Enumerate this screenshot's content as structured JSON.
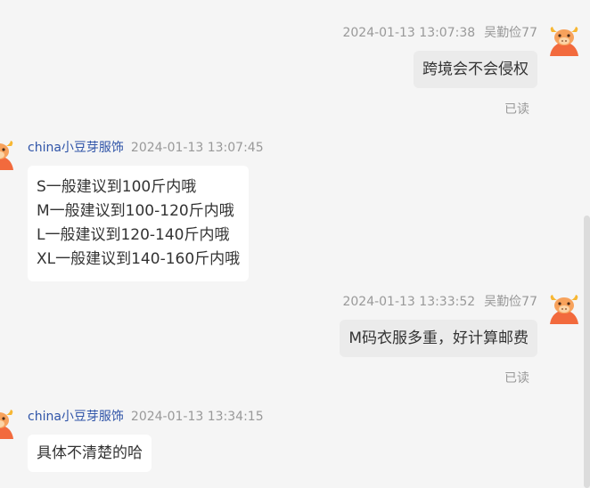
{
  "conversation": {
    "messages": [
      {
        "direction": "out",
        "timestamp": "2024-01-13 13:07:38",
        "sender": "吴勤俭77",
        "text": "跨境会不会侵权",
        "read_status": "已读"
      },
      {
        "direction": "in",
        "sender": "china小豆芽服饰",
        "timestamp": "2024-01-13 13:07:45",
        "lines": [
          "S一般建议到100斤内哦",
          "M一般建议到100-120斤内哦",
          "L一般建议到120-140斤内哦",
          "XL一般建议到140-160斤内哦"
        ]
      },
      {
        "direction": "out",
        "timestamp": "2024-01-13 13:33:52",
        "sender": "吴勤俭77",
        "text": "M码衣服多重，好计算邮费",
        "read_status": "已读"
      },
      {
        "direction": "in",
        "sender": "china小豆芽服饰",
        "timestamp": "2024-01-13 13:34:15",
        "text": "具体不清楚的哈"
      }
    ]
  },
  "avatar": {
    "icon": "cartoon-bull-avatar-icon",
    "color": "#f26a3d"
  }
}
